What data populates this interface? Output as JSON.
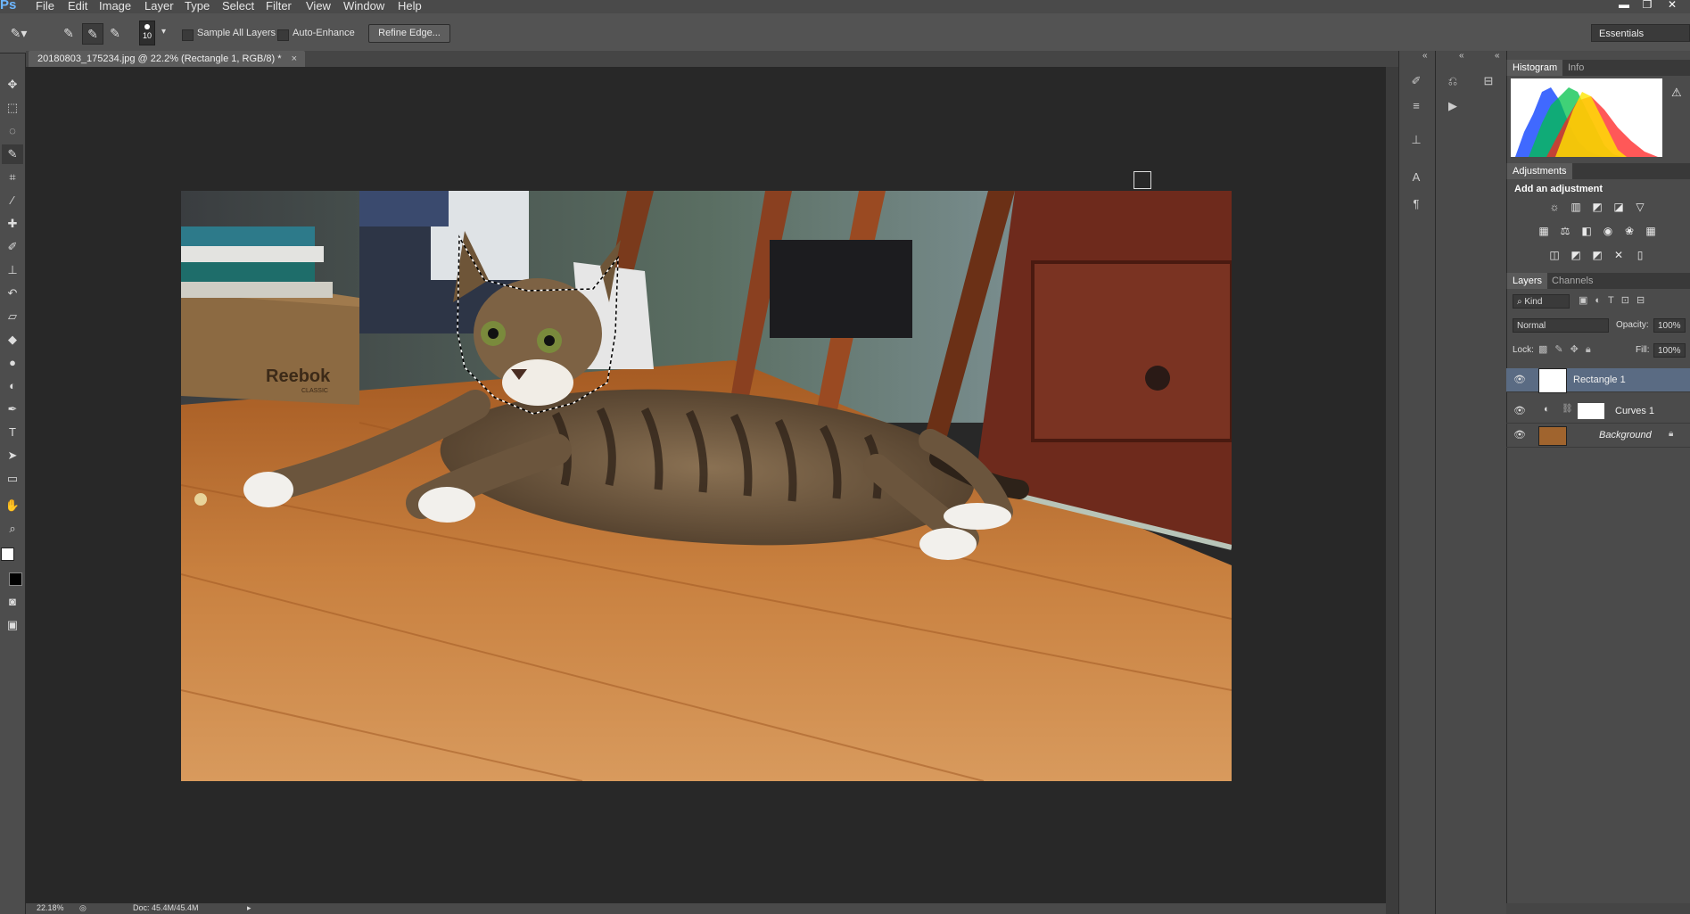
{
  "app": {
    "logo": "Ps"
  },
  "menu": [
    "File",
    "Edit",
    "Image",
    "Layer",
    "Type",
    "Select",
    "Filter",
    "View",
    "Window",
    "Help"
  ],
  "window_controls": {
    "minimize": "▬",
    "restore": "❐",
    "close": "✕"
  },
  "options": {
    "brush_size": "10",
    "sample_all_layers": "Sample All Layers",
    "auto_enhance": "Auto-Enhance",
    "refine_edge": "Refine Edge...",
    "workspace": "Essentials"
  },
  "document": {
    "tab_title": "20180803_175234.jpg @ 22.2% (Rectangle 1, RGB/8) *",
    "close": "×"
  },
  "status": {
    "zoom": "22.18%",
    "doc_size": "Doc: 45.4M/45.4M"
  },
  "photo_labels": {
    "box_brand": "Reebok",
    "box_sub": "CLASSIC"
  },
  "panels": {
    "histogram_tabs": [
      "Histogram",
      "Info"
    ],
    "histogram_warning": "⚠",
    "adjustments_tab": "Adjustments",
    "add_adjustment": "Add an adjustment",
    "layers_tabs": [
      "Layers",
      "Channels"
    ],
    "kind": "⌕ Kind",
    "blend_mode": "Normal",
    "opacity_label": "Opacity:",
    "opacity_value": "100%",
    "lock_label": "Lock:",
    "fill_label": "Fill:",
    "fill_value": "100%"
  },
  "layers": [
    {
      "name": "Rectangle 1",
      "selected": true
    },
    {
      "name": "Curves 1",
      "selected": false
    },
    {
      "name": "Background",
      "selected": false,
      "italic": true
    }
  ],
  "colors": {
    "accent_selected": "#5a6b83",
    "ps_blue": "#6db6ff",
    "floor": "#c77a36"
  }
}
